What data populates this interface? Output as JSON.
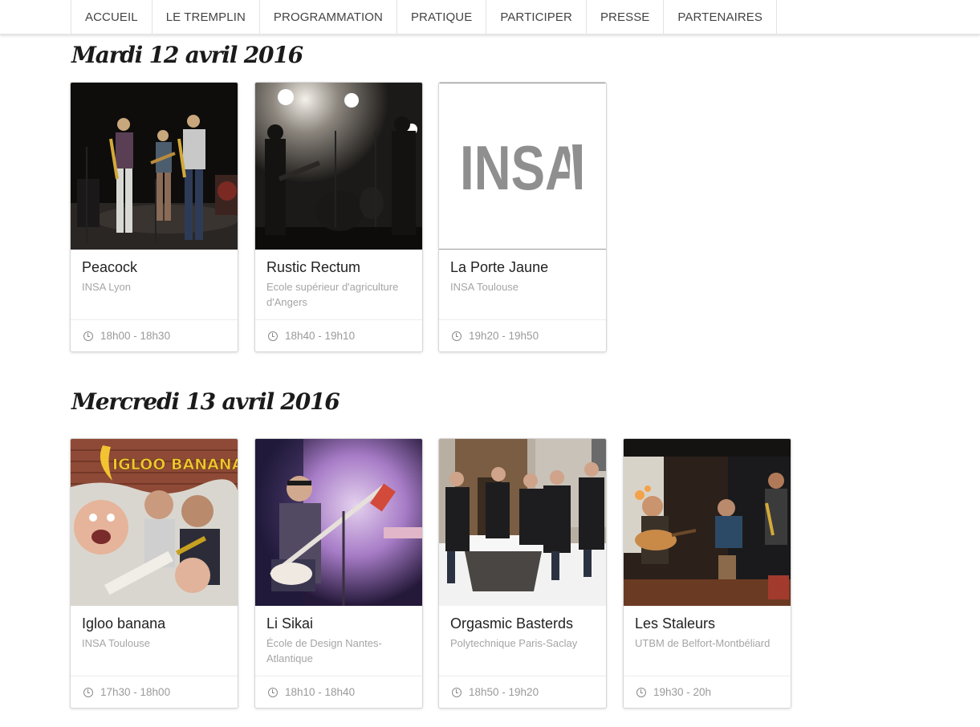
{
  "nav": {
    "items": [
      "ACCUEIL",
      "LE TREMPLIN",
      "PROGRAMMATION",
      "PRATIQUE",
      "PARTICIPER",
      "PRESSE",
      "PARTENAIRES"
    ]
  },
  "days": [
    {
      "title": "Mardi 12 avril 2016",
      "bands": [
        {
          "name": "Peacock",
          "school": "INSA Lyon",
          "time": "18h00 - 18h30",
          "photo": "band-on-stage-photo"
        },
        {
          "name": "Rustic Rectum",
          "school": "Ecole supérieur d'agriculture d'Angers",
          "time": "18h40 - 19h10",
          "photo": "band-backlit-smoke-photo"
        },
        {
          "name": "La Porte Jaune",
          "school": "INSA Toulouse",
          "time": "19h20 - 19h50",
          "photo": "insa-logo",
          "logo_text": "INSA"
        }
      ]
    },
    {
      "title": "Mercredi 13 avril 2016",
      "bands": [
        {
          "name": "Igloo banana",
          "school": "INSA Toulouse",
          "time": "17h30 - 18h00",
          "photo": "band-poster-photo",
          "poster_text": "IGLOO BANANA"
        },
        {
          "name": "Li Sikai",
          "school": "École de Design Nantes-Atlantique",
          "time": "18h10 - 18h40",
          "photo": "guitarist-purple-smoke-photo"
        },
        {
          "name": "Orgasmic Basterds",
          "school": "Polytechnique Paris-Saclay",
          "time": "18h50 - 19h20",
          "photo": "band-in-snow-photo"
        },
        {
          "name": "Les Staleurs",
          "school": "UTBM de Belfort-Montbéliard",
          "time": "19h30 - 20h",
          "photo": "band-in-bar-photo"
        }
      ]
    }
  ],
  "colors": {
    "nav_text": "#444444",
    "heading": "#1b1b1b",
    "card_title": "#222222",
    "muted": "#a5a5a5",
    "insa_gray": "#8f8f8f"
  }
}
